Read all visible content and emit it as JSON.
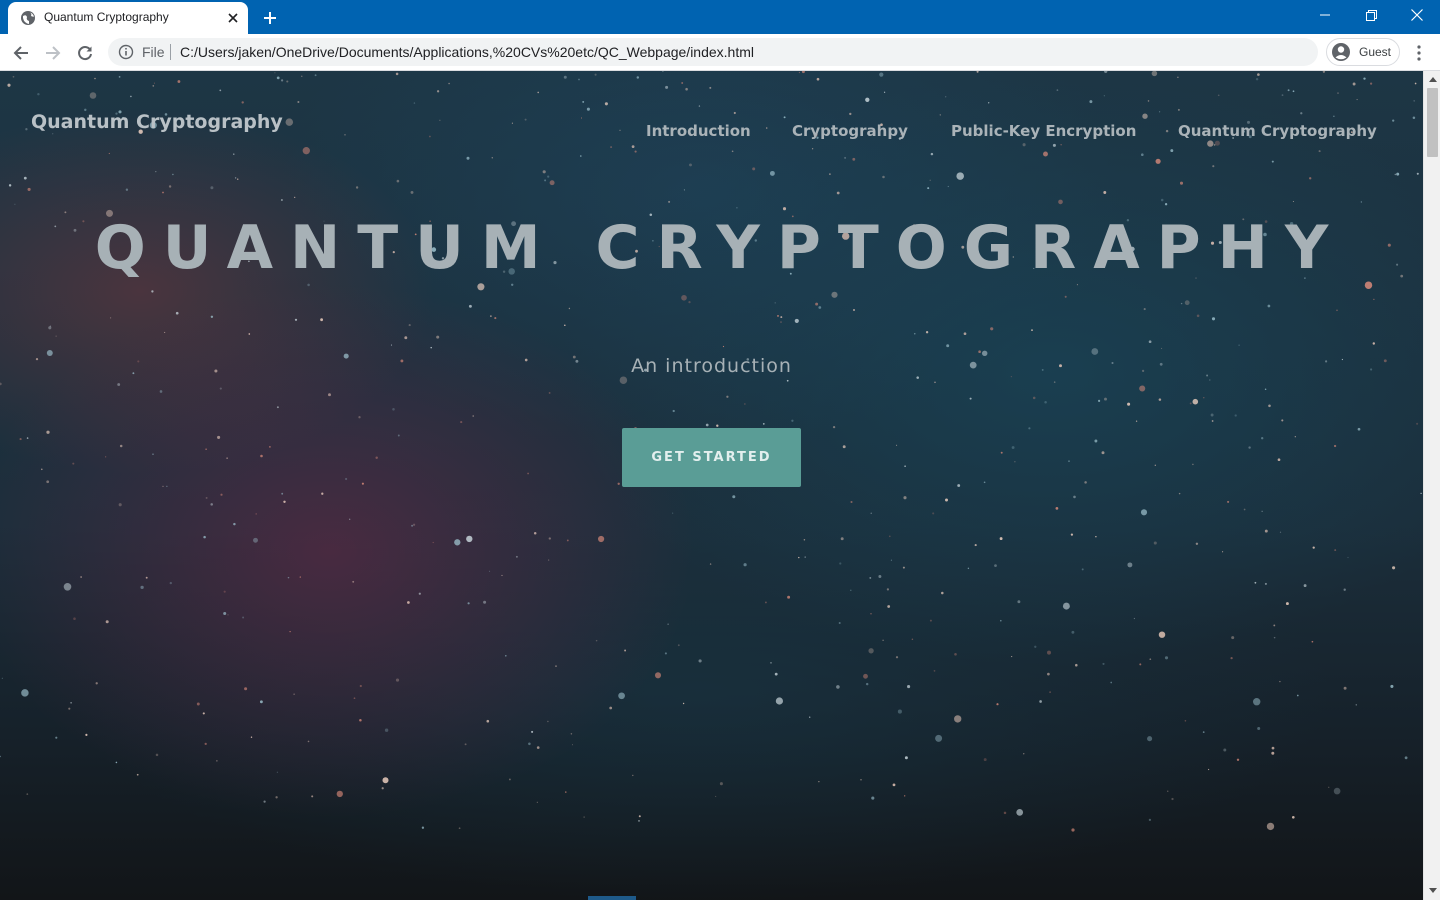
{
  "browser": {
    "tab": {
      "title": "Quantum Cryptography",
      "favicon": "globe-icon",
      "close_icon": "close-icon"
    },
    "new_tab_icon": "plus-icon",
    "window_controls": [
      "minimize-icon",
      "restore-icon",
      "close-icon"
    ],
    "address_bar": {
      "security_icon": "info-icon",
      "scheme_label": "File",
      "url": "C:/Users/jaken/OneDrive/Documents/Applications,%20CVs%20etc/QC_Webpage/index.html"
    },
    "profile": {
      "avatar_icon": "person-icon",
      "label": "Guest"
    },
    "colors": {
      "titlebar": "#0063b1",
      "tab": "#ffffff"
    }
  },
  "page": {
    "brand": "Quantum Cryptography",
    "nav": [
      {
        "label": "Introduction"
      },
      {
        "label": "Cryptograhpy"
      },
      {
        "label": "Public-Key Encryption"
      },
      {
        "label": "Quantum Cryptography"
      }
    ],
    "hero": {
      "title": "QUANTUM CRYPTOGRAPHY",
      "subtitle": "An introduction",
      "cta_label": "GET STARTED"
    },
    "colors": {
      "cta_background": "#5a9d96",
      "text": "#a7b1b6",
      "background": "#1b2e3b"
    }
  }
}
